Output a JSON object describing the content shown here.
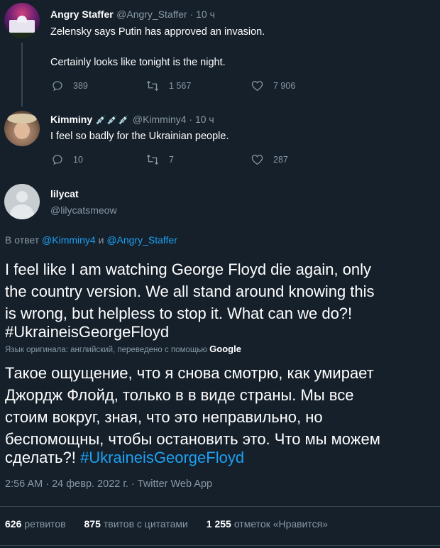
{
  "tweets": [
    {
      "name": "Angry Staffer",
      "handle": "@Angry_Staffer · 10 ч",
      "lines": [
        "Zelensky says Putin has approved an invasion.",
        "Certainly looks like tonight is the night."
      ],
      "replies": "389",
      "retweets": "1 567",
      "likes": "7 906"
    },
    {
      "name": "Kimminy",
      "name_emoji": "💉💉💉",
      "handle": "@Kimminy4 · 10 ч",
      "lines": [
        "I feel so badly for the Ukrainian people."
      ],
      "replies": "10",
      "retweets": "7",
      "likes": "287"
    }
  ],
  "main_tweet": {
    "name": "lilycat",
    "handle": "@lilycatsmeow",
    "reply_prefix": "В ответ",
    "reply_to_1": "@Kimminy4",
    "reply_and": "и",
    "reply_to_2": "@Angry_Staffer",
    "text_lines": [
      "I feel like I am watching George Floyd die again, only",
      "the country version.  We all stand around knowing this",
      "is wrong, but helpless to stop it.  What can we do?!"
    ],
    "hashtag": "#UkraineisGeorgeFloyd",
    "translation_note": "Язык оригинала: английский, переведено с помощью",
    "translation_brand": "Google",
    "translated_lines": [
      "Такое ощущение, что я снова смотрю, как умирает",
      "Джордж Флойд, только в в виде страны. Мы все",
      "стоим вокруг, зная, что это неправильно, но",
      "беспомощны, чтобы остановить это. Что мы можем"
    ],
    "translated_last": "сделать?!",
    "meta": "2:56 AM · 24 февр. 2022 г. · Twitter Web App",
    "retweets_count": "626",
    "retweets_label": "ретвитов",
    "quotes_count": "875",
    "quotes_label": "твитов с цитатами",
    "likes_count": "1 255",
    "likes_label": "отметок «Нравится»"
  },
  "colors": {
    "background": "#15202b",
    "link": "#1da1f2",
    "muted": "#8899a6"
  }
}
